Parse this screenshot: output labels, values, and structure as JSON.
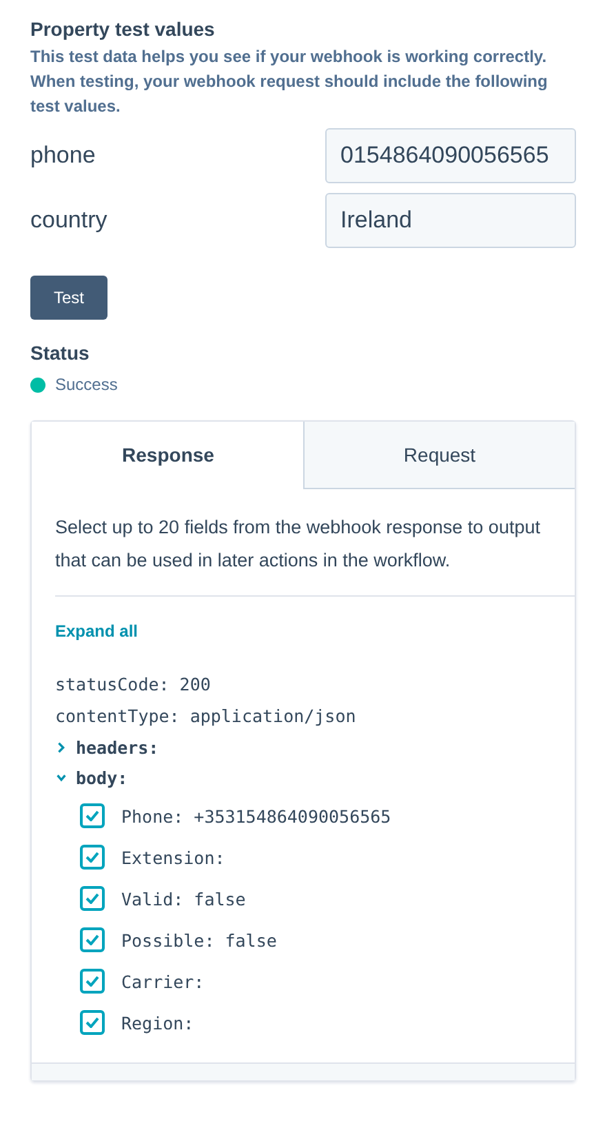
{
  "section": {
    "title": "Property test values",
    "description": "This test data helps you see if your webhook is working correctly. When testing, your webhook request should include the following test values."
  },
  "properties": [
    {
      "label": "phone",
      "value": "0154864090056565"
    },
    {
      "label": "country",
      "value": "Ireland"
    }
  ],
  "test_button": "Test",
  "status": {
    "title": "Status",
    "text": "Success",
    "color": "#00bda5"
  },
  "tabs": [
    {
      "label": "Response",
      "selected": true
    },
    {
      "label": "Request",
      "selected": false
    }
  ],
  "intro": "Select up to 20 fields from the webhook response to output that can be used in later actions in the workflow.",
  "expand_all": "Expand all",
  "tree": [
    {
      "kind": "value",
      "label": "statusCode: 200"
    },
    {
      "kind": "value",
      "label": "contentType: application/json"
    },
    {
      "kind": "group",
      "label": "headers:",
      "expanded": false
    },
    {
      "kind": "group",
      "label": "body:",
      "expanded": true,
      "children": [
        {
          "label": "Phone: +353154864090056565",
          "checked": true
        },
        {
          "label": "Extension:",
          "checked": true
        },
        {
          "label": "Valid: false",
          "checked": true
        },
        {
          "label": "Possible: false",
          "checked": true
        },
        {
          "label": "Carrier:",
          "checked": true
        },
        {
          "label": "Region:",
          "checked": true
        }
      ]
    }
  ]
}
